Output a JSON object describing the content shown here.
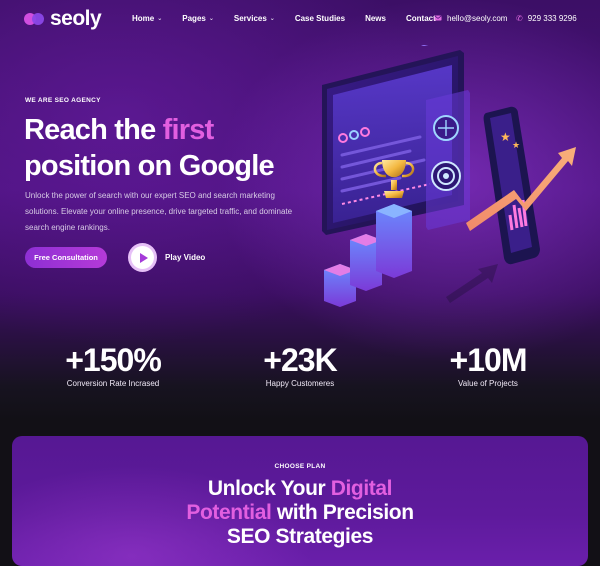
{
  "brand": {
    "name": "seoly",
    "colors": {
      "accent": "#e25fe0",
      "primary": "#9a33d6",
      "bg": "#3c0f66"
    }
  },
  "nav": {
    "items": [
      {
        "label": "Home",
        "dropdown": true
      },
      {
        "label": "Pages",
        "dropdown": true
      },
      {
        "label": "Services",
        "dropdown": true
      },
      {
        "label": "Case Studies",
        "dropdown": false
      },
      {
        "label": "News",
        "dropdown": false
      },
      {
        "label": "Contact",
        "dropdown": false
      }
    ],
    "email": "hello@seoly.com",
    "phone": "929 333 9296",
    "icons": {
      "email": "mail-icon",
      "phone": "phone-icon"
    }
  },
  "hero": {
    "eyebrow": "WE ARE SEO AGENCY",
    "headline_part1": "Reach the ",
    "headline_accent": "first",
    "headline_part2": "position on Google",
    "description": "Unlock the power of search with our expert SEO and search marketing solutions. Elevate your online presence, drive targeted traffic, and dominate search engine rankings.",
    "cta_primary": "Free Consultation",
    "cta_video": "Play Video",
    "illustration": "seo-analytics-illustration"
  },
  "stats": [
    {
      "value": "+150%",
      "label": "Conversion Rate Incrased"
    },
    {
      "value": "+23K",
      "label": "Happy Customeres"
    },
    {
      "value": "+10M",
      "label": "Value of Projects"
    }
  ],
  "plan_section": {
    "eyebrow": "CHOOSE PLAN",
    "title_line1_plain": "Unlock Your ",
    "title_line1_accent": "Digital",
    "title_line2_accent": "Potential",
    "title_line2_plain": " with Precision",
    "title_line3": "SEO Strategies"
  }
}
